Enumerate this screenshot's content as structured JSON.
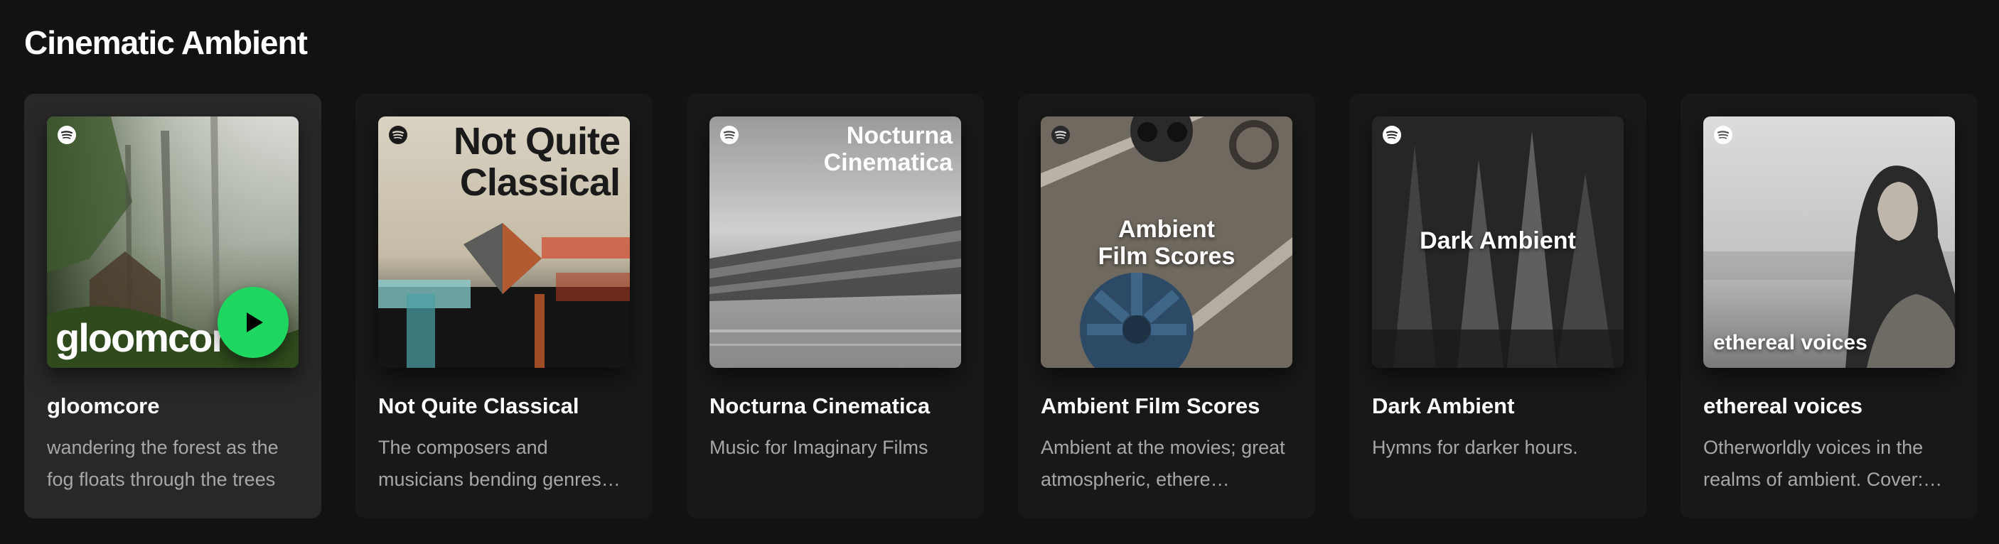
{
  "shelf": {
    "title": "Cinematic Ambient"
  },
  "colors": {
    "background": "#121212",
    "card": "#181818",
    "card_hover": "#282828",
    "accent_play": "#1ed760",
    "description": "#a7a7a7"
  },
  "cards": [
    {
      "title": "gloomcore",
      "description": "wandering the forest as the fog floats through the trees",
      "cover_text": "gloomcore",
      "hovered": true
    },
    {
      "title": "Not Quite Classical",
      "description": "The composers and musicians bending genres…",
      "cover_text_line1": "Not Quite",
      "cover_text_line2": "Classical"
    },
    {
      "title": "Nocturna Cinematica",
      "description": "Music for Imaginary Films",
      "cover_text_line1": "Nocturna",
      "cover_text_line2": "Cinematica"
    },
    {
      "title": "Ambient Film Scores",
      "description": "Ambient at the movies; great atmospheric, ethere…",
      "cover_text_line1": "Ambient",
      "cover_text_line2": "Film Scores"
    },
    {
      "title": "Dark Ambient",
      "description": "Hymns for darker hours.",
      "cover_text": "Dark Ambient"
    },
    {
      "title": "ethereal voices",
      "description": "Otherworldly voices in the realms of ambient. Cover:…",
      "cover_text": "ethereal voices"
    }
  ],
  "icons": {
    "spotify": "spotify-logo-icon",
    "play": "play-icon"
  }
}
